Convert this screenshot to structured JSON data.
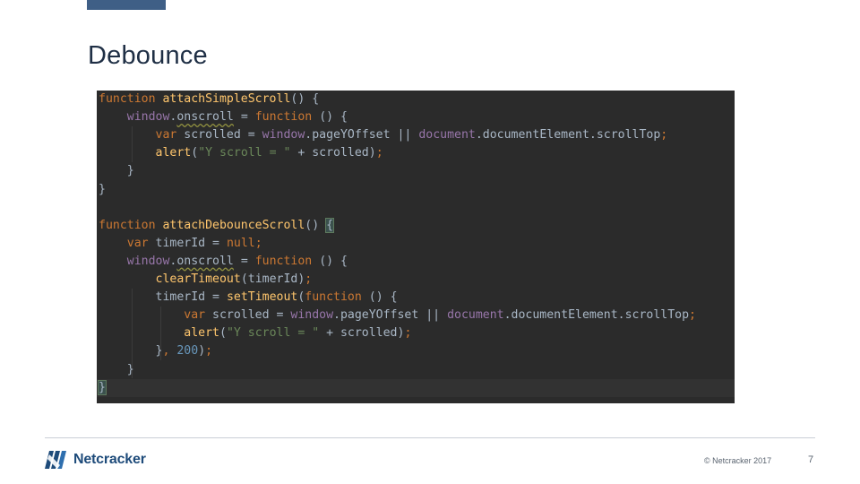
{
  "slide": {
    "title": "Debounce",
    "page_number": "7"
  },
  "footer": {
    "logo_text": "Netcracker",
    "copyright": "© Netcracker 2017"
  },
  "code": {
    "lines": [
      [
        {
          "t": "function ",
          "c": "kw"
        },
        {
          "t": "attachSimpleScroll",
          "c": "fn"
        },
        {
          "t": "() {",
          "c": ""
        }
      ],
      [
        {
          "t": "    ",
          "c": ""
        },
        {
          "t": "window",
          "c": "gl"
        },
        {
          "t": ".",
          "c": ""
        },
        {
          "t": "onscroll",
          "c": "wavy"
        },
        {
          "t": " = ",
          "c": ""
        },
        {
          "t": "function",
          "c": "kw"
        },
        {
          "t": " () {",
          "c": ""
        }
      ],
      [
        {
          "t": "        ",
          "c": ""
        },
        {
          "t": "var ",
          "c": "kw"
        },
        {
          "t": "scrolled = ",
          "c": ""
        },
        {
          "t": "window",
          "c": "gl"
        },
        {
          "t": ".pageYOffset || ",
          "c": ""
        },
        {
          "t": "document",
          "c": "gl"
        },
        {
          "t": ".documentElement.scrollTop",
          "c": ""
        },
        {
          "t": ";",
          "c": "kw"
        }
      ],
      [
        {
          "t": "        ",
          "c": ""
        },
        {
          "t": "alert",
          "c": "fn"
        },
        {
          "t": "(",
          "c": ""
        },
        {
          "t": "\"Y scroll = \"",
          "c": "str"
        },
        {
          "t": " + scrolled)",
          "c": ""
        },
        {
          "t": ";",
          "c": "kw"
        }
      ],
      [
        {
          "t": "    }",
          "c": ""
        }
      ],
      [
        {
          "t": "}",
          "c": ""
        }
      ],
      [
        {
          "t": "",
          "c": ""
        }
      ],
      [
        {
          "t": "function ",
          "c": "kw"
        },
        {
          "t": "attachDebounceScroll",
          "c": "fn"
        },
        {
          "t": "() ",
          "c": ""
        },
        {
          "t": "{",
          "c": "brace"
        }
      ],
      [
        {
          "t": "    ",
          "c": ""
        },
        {
          "t": "var ",
          "c": "kw"
        },
        {
          "t": "timerId = ",
          "c": ""
        },
        {
          "t": "null",
          "c": "kw"
        },
        {
          "t": ";",
          "c": "kw"
        }
      ],
      [
        {
          "t": "    ",
          "c": ""
        },
        {
          "t": "window",
          "c": "gl"
        },
        {
          "t": ".",
          "c": ""
        },
        {
          "t": "onscroll",
          "c": "wavy"
        },
        {
          "t": " = ",
          "c": ""
        },
        {
          "t": "function",
          "c": "kw"
        },
        {
          "t": " () {",
          "c": ""
        }
      ],
      [
        {
          "t": "        ",
          "c": ""
        },
        {
          "t": "clearTimeout",
          "c": "fn"
        },
        {
          "t": "(timerId)",
          "c": ""
        },
        {
          "t": ";",
          "c": "kw"
        }
      ],
      [
        {
          "t": "        ",
          "c": ""
        },
        {
          "t": "timerId = ",
          "c": ""
        },
        {
          "t": "setTimeout",
          "c": "fn"
        },
        {
          "t": "(",
          "c": ""
        },
        {
          "t": "function",
          "c": "kw"
        },
        {
          "t": " () {",
          "c": ""
        }
      ],
      [
        {
          "t": "            ",
          "c": ""
        },
        {
          "t": "var ",
          "c": "kw"
        },
        {
          "t": "scrolled = ",
          "c": ""
        },
        {
          "t": "window",
          "c": "gl"
        },
        {
          "t": ".pageYOffset || ",
          "c": ""
        },
        {
          "t": "document",
          "c": "gl"
        },
        {
          "t": ".documentElement.scrollTop",
          "c": ""
        },
        {
          "t": ";",
          "c": "kw"
        }
      ],
      [
        {
          "t": "            ",
          "c": ""
        },
        {
          "t": "alert",
          "c": "fn"
        },
        {
          "t": "(",
          "c": ""
        },
        {
          "t": "\"Y scroll = \"",
          "c": "str"
        },
        {
          "t": " + scrolled)",
          "c": ""
        },
        {
          "t": ";",
          "c": "kw"
        }
      ],
      [
        {
          "t": "        }",
          "c": ""
        },
        {
          "t": ", ",
          "c": "kw"
        },
        {
          "t": "200",
          "c": "num"
        },
        {
          "t": ")",
          "c": ""
        },
        {
          "t": ";",
          "c": "kw"
        }
      ],
      [
        {
          "t": "    }",
          "c": ""
        }
      ],
      [
        {
          "t": "}",
          "c": "brace"
        }
      ]
    ],
    "current_line": 16
  },
  "colors": {
    "editor_background": "#2b2b2b",
    "keyword": "#cc7832",
    "function_name": "#ffc66d",
    "global": "#9876aa",
    "string": "#6a8759",
    "number": "#6897bb",
    "brand": "#1e4b7a"
  }
}
